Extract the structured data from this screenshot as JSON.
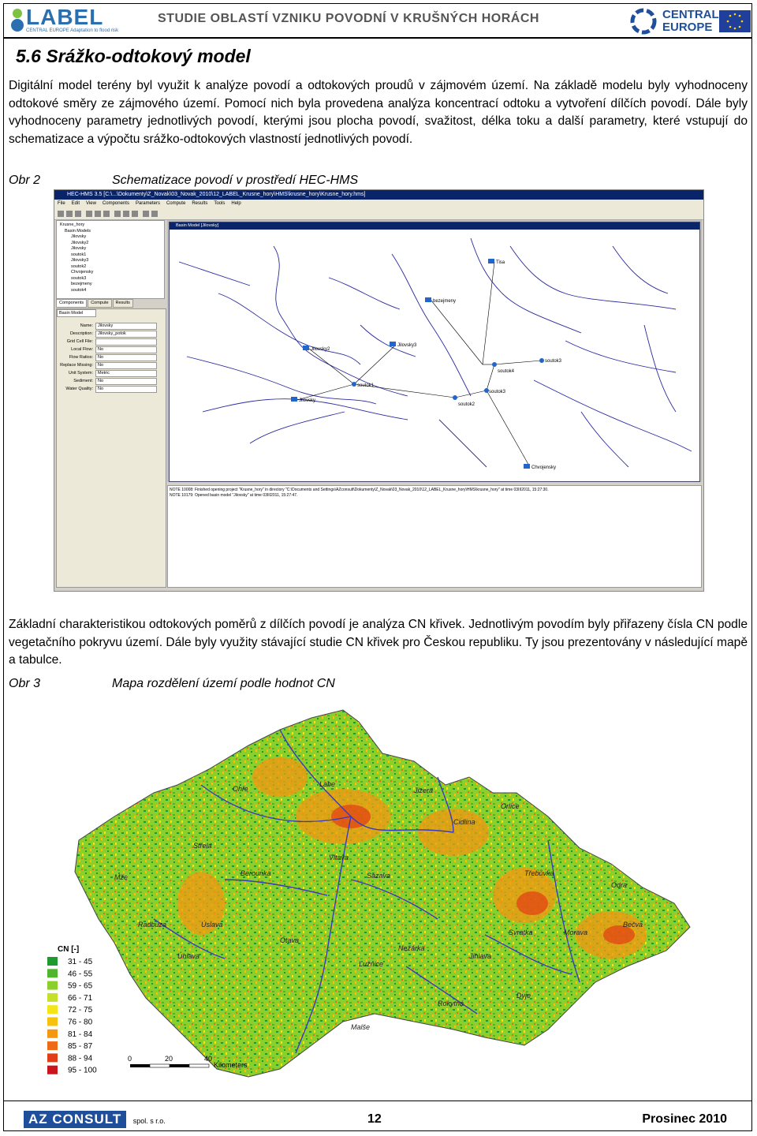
{
  "header": {
    "logo_left": "LABEL",
    "logo_left_sub": "CENTRAL EUROPE Adaptation to flood risk",
    "title": "STUDIE OBLASTÍ VZNIKU POVODNÍ V KRUŠNÝCH HORÁCH",
    "logo_right_line1": "CENTRAL",
    "logo_right_line2": "EUROPE"
  },
  "section": {
    "heading": "5.6 Srážko-odtokový model",
    "para1": "Digitální model terény byl využit k analýze povodí a odtokových proudů v zájmovém území. Na základě modelu byly vyhodnoceny odtokové směry ze zájmového území. Pomocí nich byla provedena analýza koncentrací odtoku a vytvoření dílčích povodí. Dále byly vyhodnoceny parametry jednotlivých povodí, kterými jsou plocha povodí, svažitost, délka toku a další parametry, které vstupují do schematizace a výpočtu srážko-odtokových vlastností jednotlivých povodí.",
    "para2": "Základní charakteristikou odtokových poměrů z dílčích povodí je analýza CN křivek. Jednotlivým povodím byly přiřazeny čísla CN podle vegetačního pokryvu území. Dále byly využity stávající studie CN křivek pro Českou republiku. Ty jsou prezentovány v následující mapě a tabulce."
  },
  "figure2": {
    "label": "Obr 2",
    "caption": "Schematizace povodí v prostředí HEC-HMS",
    "window_title": "HEC-HMS 3.5 [C:\\...\\Dokumenty\\Z_Novak\\03_Novak_2010\\12_LABEL_Krusne_hory\\HMS\\krusne_hory\\Krusne_hory.hms]",
    "menu": [
      "File",
      "Edit",
      "View",
      "Components",
      "Parameters",
      "Compute",
      "Results",
      "Tools",
      "Help"
    ],
    "tree_root": "Krusne_hory",
    "tree_folder": "Basin Models",
    "tree_items": [
      "Jilovsky",
      "Jilovsky2",
      "Jilovsky",
      "soutok1",
      "Jilovsky3",
      "soutok2",
      "Chvojensky",
      "soutok3",
      "bezejmeny",
      "soutok4"
    ],
    "tabs": [
      "Components",
      "Compute",
      "Results"
    ],
    "props_tab": "Basin Model",
    "props": [
      {
        "k": "Name:",
        "v": "Jilovsky"
      },
      {
        "k": "Description:",
        "v": "Jilovsky_potok"
      },
      {
        "k": "Grid Cell File:",
        "v": ""
      },
      {
        "k": "Local Flow:",
        "v": "No"
      },
      {
        "k": "Flow Ratios:",
        "v": "No"
      },
      {
        "k": "Replace Missing:",
        "v": "No"
      },
      {
        "k": "Unit System:",
        "v": "Metric"
      },
      {
        "k": "Sediment:",
        "v": "No"
      },
      {
        "k": "Water Quality:",
        "v": "No"
      }
    ],
    "map_window_title": "Basin Model [Jilovsky]",
    "nodes": [
      "Tisa",
      "bezejmeny",
      "Jilovsky3",
      "Jilovsky2",
      "soutok3",
      "soutok4",
      "soutok1",
      "soutok3",
      "soutok2",
      "Jilovsky",
      "Chvojensky"
    ],
    "log": [
      "NOTE 10008: Finished opening project \"Krusne_hory\" in directory \"C:\\Documents and Settings\\AZconsult\\Dokumenty\\Z_Novak\\03_Novak_2010\\12_LABEL_Krusne_hory\\HMS\\krusne_hory\" at time 03III2011, 15:27:30.",
      "NOTE 10179: Opened basin model \"Jilovsky\" at time 03III2011, 15:27:47."
    ]
  },
  "figure3": {
    "label": "Obr 3",
    "caption": "Mapa rozdělení území podle hodnot CN",
    "legend_title": "CN [-]",
    "legend": [
      {
        "label": "31 - 45",
        "color": "#1f9a2e"
      },
      {
        "label": "46 - 55",
        "color": "#4fb52c"
      },
      {
        "label": "59 - 65",
        "color": "#8bcf2c"
      },
      {
        "label": "66 - 71",
        "color": "#c5e02a"
      },
      {
        "label": "72 - 75",
        "color": "#f3e516"
      },
      {
        "label": "76 - 80",
        "color": "#f6c20e"
      },
      {
        "label": "81 - 84",
        "color": "#f49812"
      },
      {
        "label": "85 - 87",
        "color": "#ef6a14"
      },
      {
        "label": "88 - 94",
        "color": "#e23d14"
      },
      {
        "label": "95 - 100",
        "color": "#c9151b"
      }
    ],
    "scale_labels": [
      "0",
      "20",
      "40",
      "Kilometers"
    ],
    "rivers": [
      "Labe",
      "Ohře",
      "Vltava",
      "Berounka",
      "Sázava",
      "Jizera",
      "Cidlina",
      "Orlice",
      "Svratka",
      "Jihlava",
      "Dyje",
      "Morava",
      "Odra",
      "Otava",
      "Lužnice",
      "Radbuza",
      "Úhlava",
      "Nežárka",
      "Malše",
      "Rokytná",
      "Bečva",
      "Třebůvka",
      "Úslava",
      "Střela",
      "Mže"
    ]
  },
  "footer": {
    "logo": "AZ CONSULT",
    "logo_sub": "spol. s r.o.",
    "page": "12",
    "date": "Prosinec 2010"
  }
}
